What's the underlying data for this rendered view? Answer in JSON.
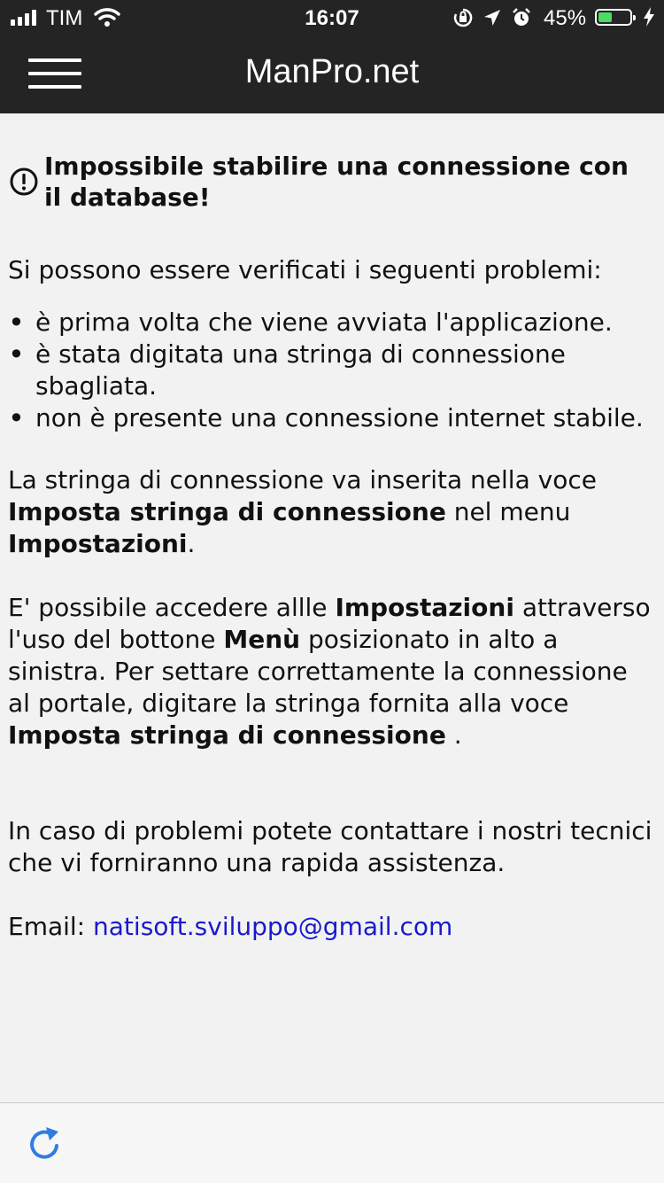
{
  "status_bar": {
    "carrier": "TIM",
    "time": "16:07",
    "battery_percent": "45%",
    "battery_level": 0.45,
    "battery_color": "#4cd964",
    "icons": [
      "signal-icon",
      "wifi-icon",
      "orientation-lock-icon",
      "location-arrow-icon",
      "alarm-icon",
      "battery-icon",
      "charging-bolt-icon"
    ]
  },
  "header": {
    "title": "ManPro.net",
    "menu_icon": "hamburger-menu-icon",
    "background": "#242424"
  },
  "main": {
    "heading": "Impossibile stabilire una connessione con il database!",
    "heading_icon": "exclamation-circle-icon",
    "intro": "Si possono essere verificati i seguenti problemi:",
    "problems": [
      "è prima volta che viene avviata l'applicazione.",
      "è stata digitata una stringa di connessione sbagliata.",
      "non è presente una connessione internet stabile."
    ],
    "para1": {
      "t1": "La stringa di connessione va inserita nella voce ",
      "b1": "Imposta stringa di connessione",
      "t2": " nel menu ",
      "b2": "Impostazioni",
      "t3": "."
    },
    "para2": {
      "t1": "E' possibile accedere allle ",
      "b1": "Impostazioni",
      "t2": " attraverso l'uso del bottone ",
      "b2": "Menù",
      "t3": " posizionato in alto a sinistra. Per settare correttamente la connessione al portale, digitare la stringa fornita alla voce ",
      "b3": "Imposta stringa di connessione",
      "t4": " ."
    },
    "para3": "In caso di problemi potete contattare i nostri tecnici che vi forniranno una rapida assistenza.",
    "email_label": "Email: ",
    "email_link": "natisoft.sviluppo@gmail.com",
    "link_color": "#1a1acc"
  },
  "toolbar": {
    "reload_icon": "reload-icon",
    "accent": "#2f7de1"
  }
}
